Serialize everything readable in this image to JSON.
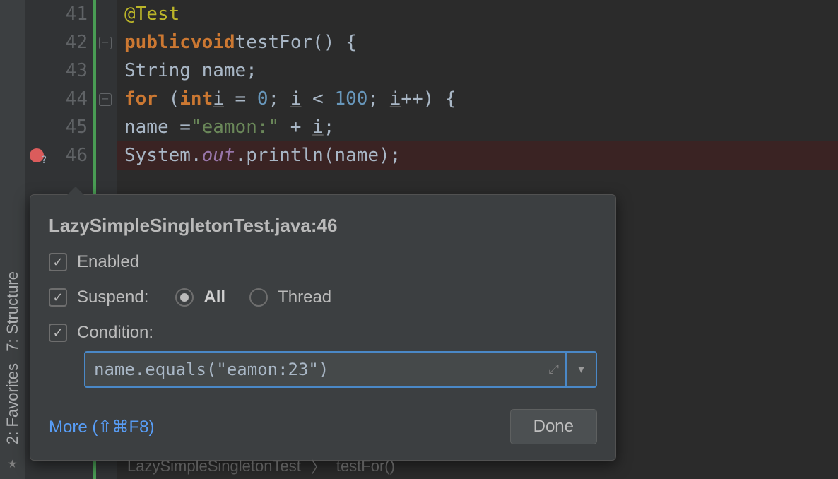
{
  "tool_tabs": {
    "structure": "7: Structure",
    "favorites": "2: Favorites"
  },
  "lines": {
    "l41": "41",
    "l42": "42",
    "l43": "43",
    "l44": "44",
    "l45": "45",
    "l46": "46"
  },
  "code": {
    "annot": "@Test",
    "pub": "public",
    "void": "void",
    "testfor": "testFor",
    "paren_open": "() {",
    "string_name": "String name;",
    "for_kw": "for",
    "int_kw": "int",
    "i1": "i",
    "eq0": " = ",
    "zero": "0",
    "semi1": "; ",
    "i2": "i",
    "lt": " < ",
    "hundred": "100",
    "semi2": "; ",
    "i3": "i",
    "pp": "++) {",
    "name_assign_pre": "name =",
    "eamon_str": "\"eamon:\"",
    "plus": " + ",
    "i4": "i",
    "semi3": ";",
    "sys": "System.",
    "out": "out",
    "println": ".println(name);"
  },
  "popup": {
    "title": "LazySimpleSingletonTest.java:46",
    "enabled": "Enabled",
    "suspend": "Suspend:",
    "all": "All",
    "thread": "Thread",
    "condition": "Condition:",
    "condition_value": "name.equals(\"eamon:23\")",
    "more": "More (⇧⌘F8)",
    "done": "Done"
  },
  "breadcrumbs": {
    "b1": "LazySimpleSingletonTest",
    "b2": "testFor()"
  }
}
